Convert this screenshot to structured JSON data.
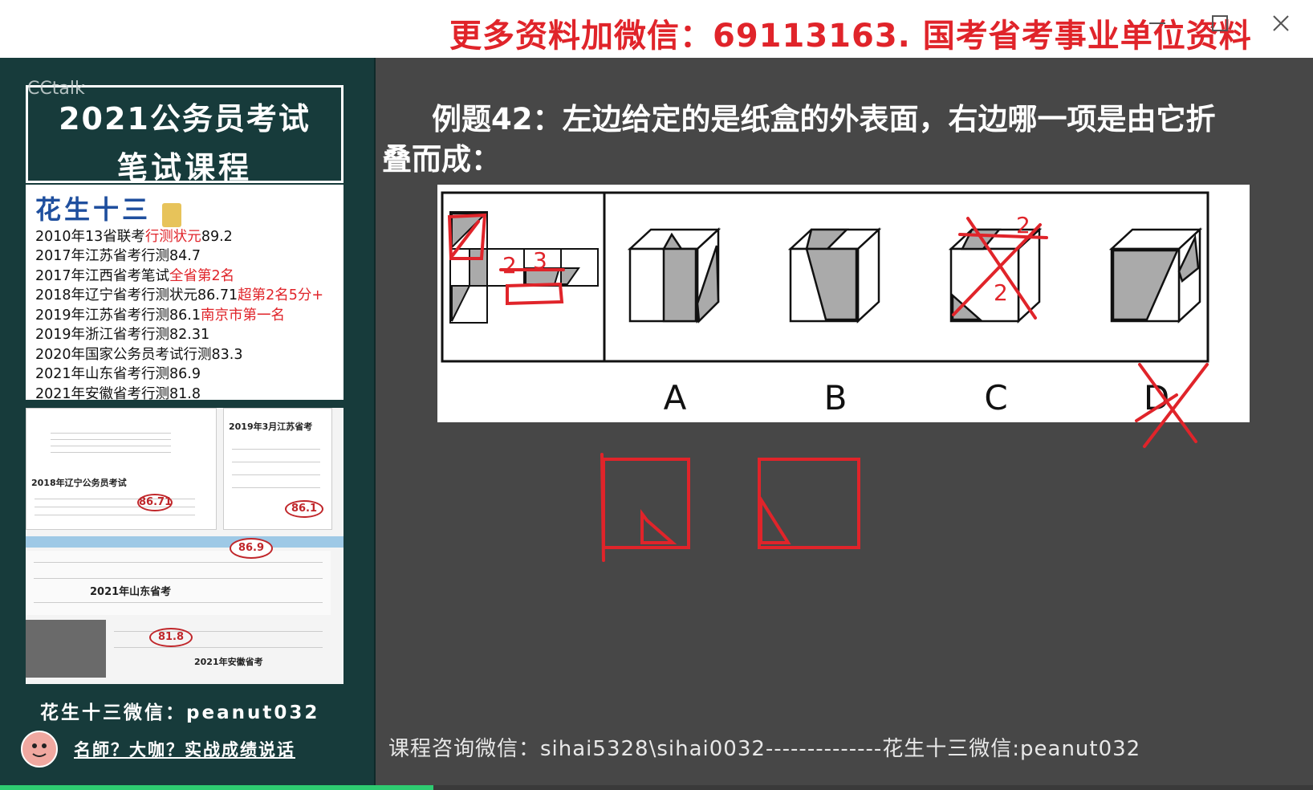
{
  "window": {
    "title": "更多资料加微信：69113163. 国考省考事业单位资料",
    "title_color": "#e0242a",
    "minimize_icon": "minimize-icon",
    "maximize_icon": "maximize-icon",
    "close_icon": "close-icon"
  },
  "sidebar": {
    "watermark": "CCtalk",
    "course_title_line1": "2021公务员考试",
    "course_title_line2": "笔试课程",
    "teacher_name": "花生十三",
    "credentials": [
      {
        "text": "2010年13省联考",
        "highlight": "行测状元",
        "tail": "89.2"
      },
      {
        "text": "2017年江苏省考行测84.7",
        "highlight": "",
        "tail": ""
      },
      {
        "text": "2017年江西省考笔试",
        "highlight": "全省第2名",
        "tail": ""
      },
      {
        "text": "2018年辽宁省考行测状元86.71",
        "highlight": "超第2名5分+",
        "tail": ""
      },
      {
        "text": "2019年江苏省考行测86.1",
        "highlight": "南京市第一名",
        "tail": ""
      },
      {
        "text": "2019年浙江省考行测82.31",
        "highlight": "",
        "tail": ""
      },
      {
        "text": "2020年国家公务员考试行测83.3",
        "highlight": "",
        "tail": ""
      },
      {
        "text": "2021年山东省考行测86.9",
        "highlight": "",
        "tail": ""
      },
      {
        "text": "2021年安徽省考行测81.8",
        "highlight": "",
        "tail": ""
      }
    ],
    "score_screens": {
      "doc1_title": "2019年3月江苏省考",
      "doc2_title": "2018年辽宁公务员考试",
      "doc3_title": "2021年山东省考",
      "doc4_title": "2021年安徽省考",
      "scores": [
        "86.71",
        "86.1",
        "86.9",
        "81.8"
      ]
    },
    "wechat": "花生十三微信：peanut032",
    "slogan": "名師？大咖？实战成绩说话"
  },
  "main": {
    "question_line1": "例题42：左边给定的是纸盒的外表面，右边哪一项是由它折",
    "question_line2": "叠而成：",
    "options": [
      "A",
      "B",
      "C",
      "D"
    ],
    "annotations": [
      "2",
      "3",
      "2",
      "2"
    ],
    "footer": "课程咨询微信：sihai5328\\sihai0032--------------花生十三微信:peanut032"
  },
  "playback": {
    "progress": 0.33,
    "progress_color": "#2ecc71"
  }
}
